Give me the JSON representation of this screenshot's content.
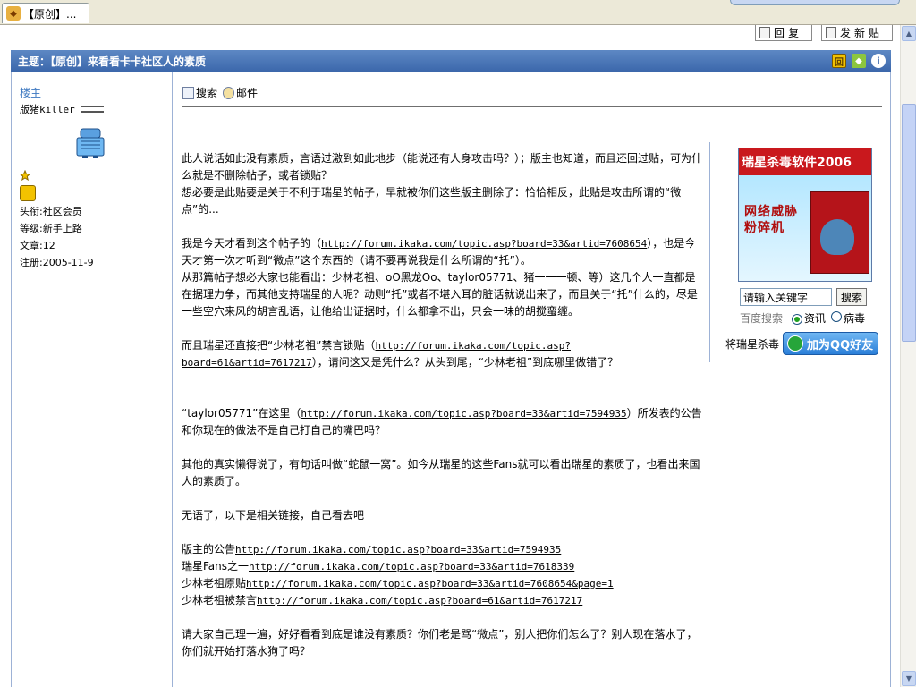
{
  "browser": {
    "tab_title": "【原创】..."
  },
  "toolbar": {
    "reply_label": "回复",
    "new_post_label": "发新贴"
  },
  "topic": {
    "title": "主题：【原创】来看看卡卡社区人的素质"
  },
  "author": {
    "role": "楼主",
    "name": "版猪killer",
    "title_line": "头衔:社区会员",
    "level_line": "等级:新手上路",
    "posts_line": "文章:12",
    "registered_line": "注册:2005-11-9"
  },
  "tools": {
    "search": "搜索",
    "mail": "邮件"
  },
  "post": {
    "p1a": "此人说话如此没有素质，言语过激到如此地步（能说还有人身攻击吗？）；版主也知道，而且还回过贴，可为什么就是不删除帖子，或者锁贴？",
    "p1b": "想必要是此贴要是关于不利于瑞星的帖子，早就被你们这些版主删除了：恰恰相反，此贴是攻击所谓的“微点”的...",
    "p2a_pre": "我是今天才看到这个帖子的（",
    "p2a_link": "http://forum.ikaka.com/topic.asp?board=33&artid=7608654",
    "p2a_post": "），也是今天才第一次才听到“微点”这个东西的（请不要再说我是什么所谓的“托”）。",
    "p2b": "从那篇帖子想必大家也能看出：少林老祖、oO黑龙Oo、taylor05771、猪一一一顿、等）这几个人一直都是在据理力争，而其他支持瑞星的人呢？动则“托”或者不堪入耳的脏话就说出来了，而且关于“托”什么的，尽是一些空穴来风的胡言乱语，让他给出证据时，什么都拿不出，只会一味的胡搅蛮缠。",
    "p3_pre": "而且瑞星还直接把“少林老祖”禁言锁贴（",
    "p3_link": "http://forum.ikaka.com/topic.asp?board=61&artid=7617217",
    "p3_post": "），请问这又是凭什么？从头到尾，“少林老祖”到底哪里做错了？",
    "p4_pre": "“taylor05771”在这里（",
    "p4_link": "http://forum.ikaka.com/topic.asp?board=33&artid=7594935",
    "p4_post": "）所发表的公告和你现在的做法不是自己打自己的嘴巴吗？",
    "p5": "其他的真实懒得说了，有句话叫做“蛇鼠一窝”。如今从瑞星的这些Fans就可以看出瑞星的素质了，也看出来国人的素质了。",
    "p6": "无语了，以下是相关链接，自己看去吧",
    "links": [
      {
        "label": "版主的公告",
        "url": "http://forum.ikaka.com/topic.asp?board=33&artid=7594935"
      },
      {
        "label": "瑞星Fans之一",
        "url": "http://forum.ikaka.com/topic.asp?board=33&artid=7618339"
      },
      {
        "label": "少林老祖原贴",
        "url": "http://forum.ikaka.com/topic.asp?board=33&artid=7608654&page=1"
      },
      {
        "label": "少林老祖被禁言",
        "url": "http://forum.ikaka.com/topic.asp?board=61&artid=7617217"
      }
    ],
    "p7": "请大家自己理一遍，好好看看到底是谁没有素质？你们老是骂“微点”，别人把你们怎么了？别人现在落水了，你们就开始打落水狗了吗？"
  },
  "sidebar_ad": {
    "banner_title": "瑞星杀毒软件2006",
    "slogan_line1": "网络威胁",
    "slogan_line2": "粉碎机",
    "search_placeholder": "请输入关键字",
    "search_button": "搜索",
    "baidu_label": "百度搜索",
    "radio_news": "资讯",
    "radio_virus": "病毒",
    "qq_prefix": "将瑞星杀毒",
    "qq_button": "加为QQ好友"
  },
  "colors": {
    "topic_bar": "#3a66aa",
    "frame_border": "#9db2d6",
    "role_text": "#3b77c0",
    "ad_red": "#c9181d"
  }
}
